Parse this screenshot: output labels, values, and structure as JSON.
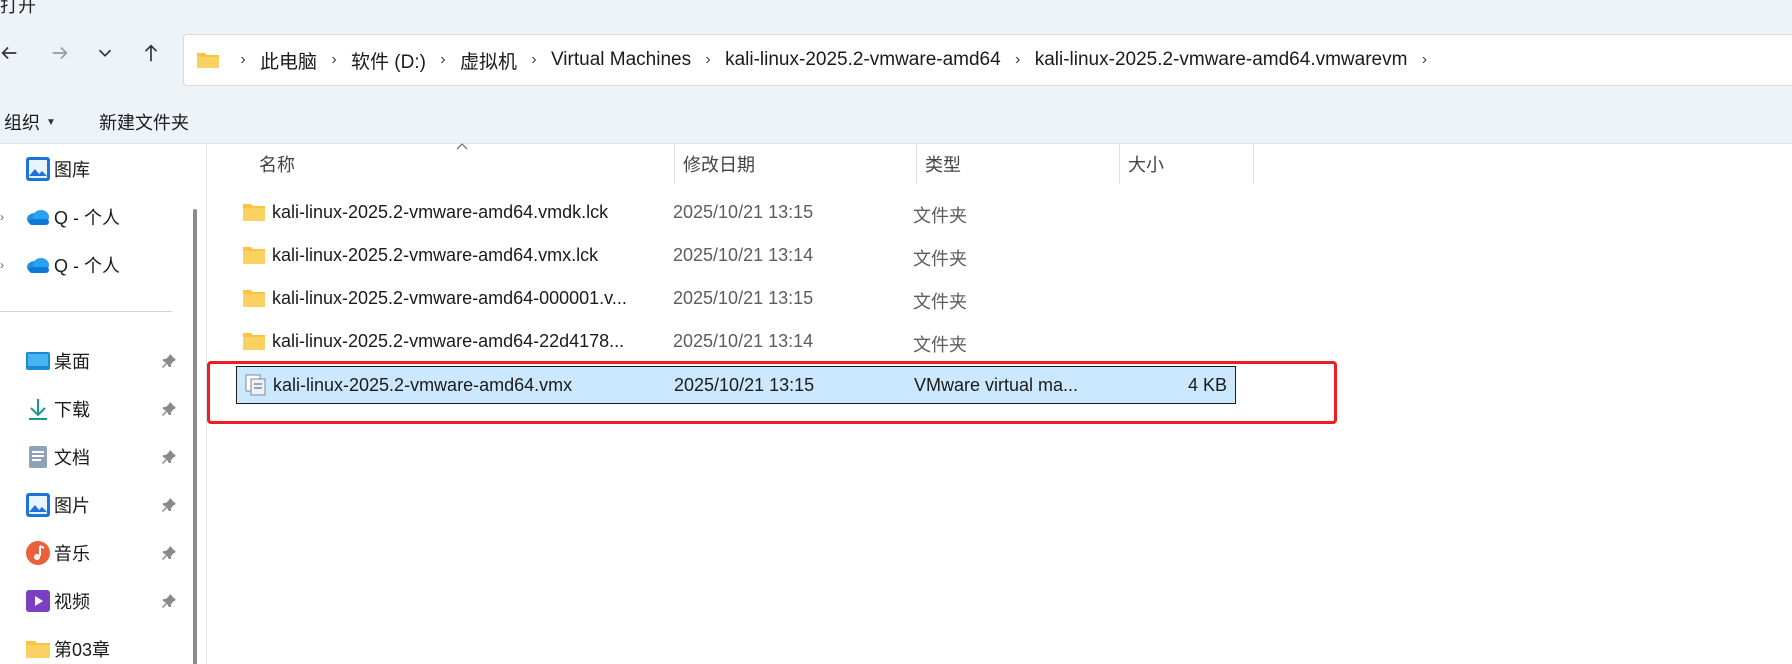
{
  "window": {
    "title": "打开"
  },
  "address": {
    "crumbs": [
      "此电脑",
      "软件 (D:)",
      "虚拟机",
      "Virtual Machines",
      "kali-linux-2025.2-vmware-amd64",
      "kali-linux-2025.2-vmware-amd64.vmwarevm"
    ]
  },
  "toolbar": {
    "organize_label": "组织",
    "new_folder_label": "新建文件夹"
  },
  "sidebar": {
    "items": [
      {
        "label": "图库",
        "icon": "gallery-icon"
      },
      {
        "label": "Q - 个人",
        "icon": "onedrive-icon"
      },
      {
        "label": "Q - 个人",
        "icon": "onedrive-icon"
      },
      {
        "label": "桌面",
        "icon": "desktop-icon"
      },
      {
        "label": "下载",
        "icon": "download-icon"
      },
      {
        "label": "文档",
        "icon": "document-icon"
      },
      {
        "label": "图片",
        "icon": "pictures-icon"
      },
      {
        "label": "音乐",
        "icon": "music-icon"
      },
      {
        "label": "视频",
        "icon": "videos-icon"
      },
      {
        "label": "第03章",
        "icon": "folder-icon"
      }
    ]
  },
  "columns": {
    "name": "名称",
    "modified": "修改日期",
    "type": "类型",
    "size": "大小"
  },
  "files": [
    {
      "name": "kali-linux-2025.2-vmware-amd64.vmdk.lck",
      "modified": "2025/10/21 13:15",
      "type": "文件夹",
      "size": "",
      "icon": "folder-icon"
    },
    {
      "name": "kali-linux-2025.2-vmware-amd64.vmx.lck",
      "modified": "2025/10/21 13:14",
      "type": "文件夹",
      "size": "",
      "icon": "folder-icon"
    },
    {
      "name": "kali-linux-2025.2-vmware-amd64-000001.v...",
      "modified": "2025/10/21 13:15",
      "type": "文件夹",
      "size": "",
      "icon": "folder-icon"
    },
    {
      "name": "kali-linux-2025.2-vmware-amd64-22d4178...",
      "modified": "2025/10/21 13:14",
      "type": "文件夹",
      "size": "",
      "icon": "folder-icon"
    },
    {
      "name": "kali-linux-2025.2-vmware-amd64.vmx",
      "modified": "2025/10/21 13:15",
      "type": "VMware virtual ma...",
      "size": "4 KB",
      "icon": "vmx-file-icon"
    }
  ],
  "colors": {
    "selection": "#cce8ff",
    "highlight": "#ee1d23",
    "chrome": "#eef3f8"
  }
}
